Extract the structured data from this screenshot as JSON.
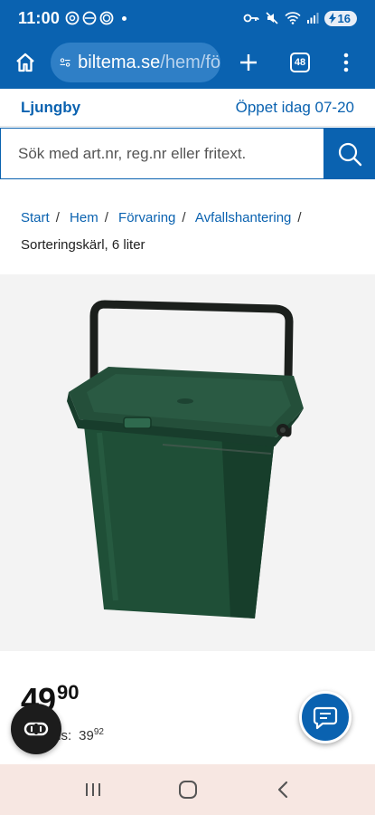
{
  "status": {
    "time": "11:00",
    "battery": "16"
  },
  "browser": {
    "url_host": "biltema.se",
    "url_path": "/hem/fö",
    "tab_count": "48"
  },
  "store": {
    "name": "Ljungby",
    "hours": "Öppet idag 07-20"
  },
  "search": {
    "placeholder": "Sök med art.nr, reg.nr eller fritext."
  },
  "breadcrumb": {
    "items": [
      "Start",
      "Hem",
      "Förvaring",
      "Avfallshantering"
    ],
    "separator": "/",
    "current": "Sorteringskärl, 6 liter"
  },
  "product": {
    "price_whole": "49",
    "price_cents": "90",
    "member_label": "Klubbpris Biltemas:",
    "member_visible_label": "ms:",
    "member_price_whole": "39",
    "member_price_cents": "92"
  },
  "colors": {
    "brand_blue": "#0a62b0",
    "bucket_green": "#1e4d36"
  }
}
